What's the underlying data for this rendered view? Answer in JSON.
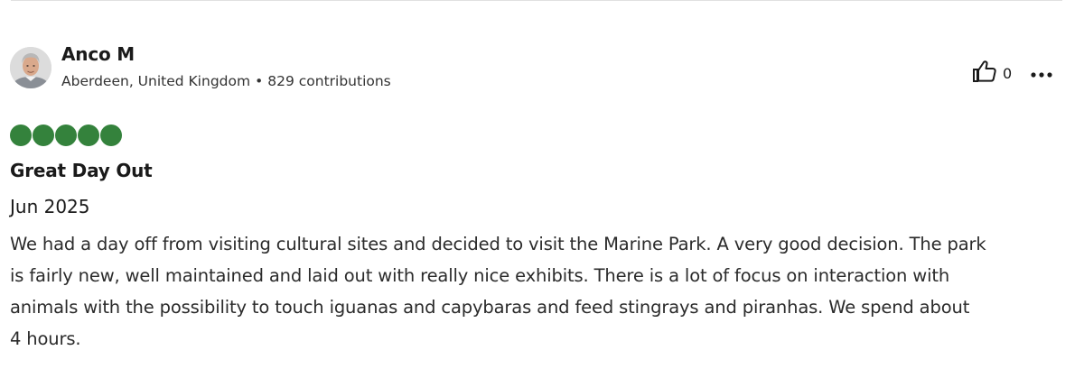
{
  "review": {
    "user": {
      "name": "Anco M",
      "location": "Aberdeen, United Kingdom",
      "separator": "•",
      "contributions": "829 contributions"
    },
    "helpful": {
      "count": "0",
      "icon": "thumbs-up-icon"
    },
    "more_icon": "more-options-icon",
    "rating": {
      "value": 5,
      "max": 5,
      "color": "#34823c"
    },
    "title": "Great Day Out",
    "date": "Jun 2025",
    "body_lines": [
      "We had a day off from visiting cultural sites and decided to visit the Marine Park. A very good decision. The park",
      "is fairly new, well maintained and laid out with really nice exhibits. There is a lot of focus on interaction with",
      "animals with the possibility to touch iguanas and capybaras and feed stingrays and piranhas. We spend about",
      "4 hours."
    ]
  }
}
